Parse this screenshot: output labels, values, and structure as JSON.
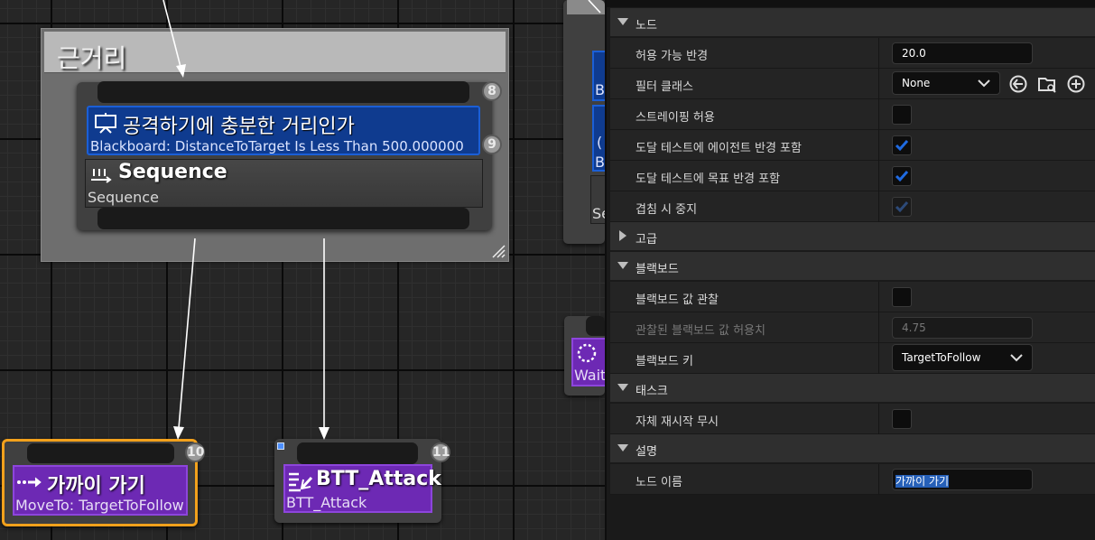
{
  "graph": {
    "comment": {
      "title": "근거리"
    },
    "composite": {
      "top_index": "8",
      "decorator": {
        "title": "공격하기에 충분한 거리인가",
        "description": "Blackboard: DistanceToTarget Is Less Than 500.000000",
        "index": "9"
      },
      "sequence": {
        "title": "Sequence",
        "description": "Sequence"
      }
    },
    "tasks": [
      {
        "title": "가까이 가기",
        "description": "MoveTo: TargetToFollow",
        "index": "10"
      },
      {
        "title": "BTT_Attack",
        "description": "BTT_Attack",
        "index": "11"
      }
    ],
    "partial_nodes": {
      "right_top": {
        "line1": "B",
        "line2": "(",
        "line3": "B",
        "line4": "Se"
      },
      "wait": {
        "label": "Wait"
      }
    }
  },
  "details": {
    "sections": {
      "node": "노드",
      "advanced": "고급",
      "blackboard": "블랙보드",
      "task": "태스크",
      "description": "설명"
    },
    "node_props": {
      "acceptable_radius": {
        "label": "허용 가능 반경",
        "value": "20.0"
      },
      "filter_class": {
        "label": "필터 클래스",
        "value": "None"
      },
      "allow_strafe": {
        "label": "스트레이핑 허용",
        "checked": false
      },
      "reach_test_agent_radius": {
        "label": "도달 테스트에 에이전트 반경 포함",
        "checked": true
      },
      "reach_test_goal_radius": {
        "label": "도달 테스트에 목표 반경 포함",
        "checked": true
      },
      "stop_on_overlap": {
        "label": "겹침 시 중지",
        "checked": true
      }
    },
    "blackboard_props": {
      "observe_value": {
        "label": "블랙보드 값 관찰",
        "checked": false
      },
      "observed_tolerance": {
        "label": "관찰된 블랙보드 값 허용치",
        "value": "4.75"
      },
      "blackboard_key": {
        "label": "블랙보드 키",
        "value": "TargetToFollow"
      }
    },
    "task_props": {
      "ignore_restart_self": {
        "label": "자체 재시작 무시",
        "checked": false
      }
    },
    "description_props": {
      "node_name": {
        "label": "노드 이름",
        "value": "가까이 가기"
      }
    }
  },
  "colors": {
    "decorator_blue": "#0f3b8f",
    "task_purple": "#6d29b4",
    "selection_orange": "#f2a11c",
    "checkbox_blue": "#1f6ae0"
  }
}
